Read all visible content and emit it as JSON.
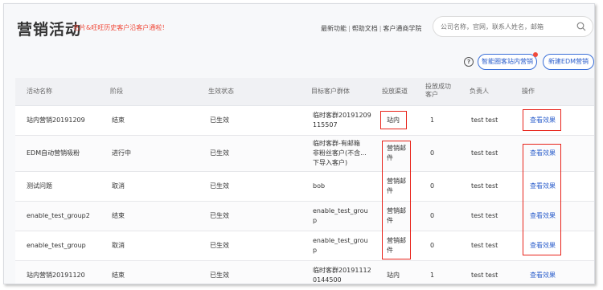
{
  "header": {
    "title": "营销活动",
    "subtitle": "名片&旺旺历史客户沿客户通啦！",
    "links": [
      "最新功能",
      "帮助文档",
      "客户通商学院"
    ],
    "search_placeholder": "公司名称，官网，联系人姓名，邮箱"
  },
  "actions": {
    "smart_button": "智能圈客站内营销",
    "new_edm_button": "新建EDM营销",
    "help": "?"
  },
  "table": {
    "columns": [
      "活动名称",
      "阶段",
      "生效状态",
      "目标客户群体",
      "投放渠道",
      "投放成功客户",
      "负责人",
      "操作"
    ],
    "rows": [
      {
        "name": "站内营销20191209",
        "stage": "结束",
        "status": "已生效",
        "target": [
          "临时客群20191209",
          "115507"
        ],
        "channel": [
          "站内"
        ],
        "success": "1",
        "owner": "test test",
        "op": "查看效果"
      },
      {
        "name": "EDM自动营销吸粉",
        "stage": "进行中",
        "status": "已生效",
        "target": [
          "临时客群-有邮箱",
          "非粉丝客户(不含...",
          "下导入客户)"
        ],
        "channel": [
          "营销邮",
          "件"
        ],
        "success": "0",
        "owner": "test test",
        "op": "查看效果"
      },
      {
        "name": "测试问题",
        "stage": "取消",
        "status": "已生效",
        "target": [
          "bob"
        ],
        "channel": [
          "营销邮",
          "件"
        ],
        "success": "0",
        "owner": "test test",
        "op": "查看效果"
      },
      {
        "name": "enable_test_group2",
        "stage": "结束",
        "status": "已生效",
        "target": [
          "enable_test_grou",
          "p"
        ],
        "channel": [
          "营销邮",
          "件"
        ],
        "success": "0",
        "owner": "test test",
        "op": "查看效果"
      },
      {
        "name": "enable_test_group",
        "stage": "取消",
        "status": "已生效",
        "target": [
          "enable_test_grou",
          "p"
        ],
        "channel": [
          "营销邮",
          "件"
        ],
        "success": "0",
        "owner": "test test",
        "op": "查看效果"
      },
      {
        "name": "站内营销20191120",
        "stage": "结束",
        "status": "已生效",
        "target": [
          "临时客群20191112",
          "0144500"
        ],
        "channel": [
          "站内"
        ],
        "success": "1",
        "owner": "test test",
        "op": "查看效果"
      }
    ]
  }
}
